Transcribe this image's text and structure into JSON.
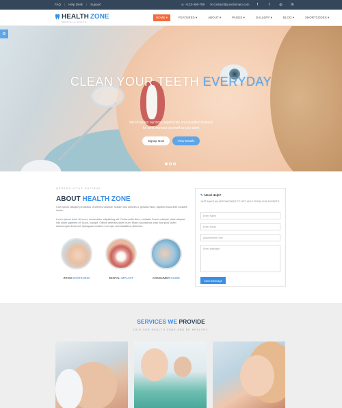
{
  "topbar": {
    "links": [
      "FAQ",
      "Help Desk",
      "Support"
    ],
    "phone": "+123-456-789",
    "email": "contact@yourdomain.com"
  },
  "header": {
    "logo_main": "HEALTH",
    "logo_accent": "ZONE",
    "logo_tagline": "MEDICAL & HEALTH",
    "nav": [
      "HOME",
      "FEATURES",
      "ABOUT",
      "PAGES",
      "GALLERY",
      "BLOG",
      "SHORTCODES"
    ]
  },
  "hero": {
    "title_main": "CLEAN YOUR TEETH",
    "title_accent": "EVERYDAY",
    "subtitle_line1": "We Provides our best opportunity and qualified trainers",
    "subtitle_line2": "for best workout yourself as you want",
    "signup_label": "Signup Now",
    "details_label": "View Details"
  },
  "about": {
    "eyebrow": "QPRADA VITAE DAPIBUS",
    "title_main": "ABOUT",
    "title_accent": "HEALTH ZONE",
    "p1": "Cum sociis natoque penatibus et ultrices volutpat. Nullam wisi ultricies a, gravida vitae, dapibus risus ante sodales lectus.",
    "p2_lead": "Lorem ipsum dolor sit amet",
    "p2": ", consectetur adipisicing elit. Perferendis illum, veritatis! Fusce volutpat, vitae aliquam iste ullam sapiente id! Quos, suscipit. Officiis delectus opimi eum! Etiam accusamus cras tica quos totam doloremque deserunt. Quisquam incidunt eum quo necessitatibus delectus.",
    "features": [
      {
        "name": "ZOOM",
        "accent": "WHITENING"
      },
      {
        "name": "DENTAL",
        "accent": "IMPLANT"
      },
      {
        "name": "CONSUMER",
        "accent": "GUIDE"
      }
    ]
  },
  "appointment": {
    "title": "Need Help?",
    "description": "JUST MAKE AN APPOINTMENT TO GET HELP FROM OUR EXPERTS.",
    "name_placeholder": "Enter Name",
    "email_placeholder": "Enter Email",
    "date_placeholder": "Appointment Date",
    "message_placeholder": "Enter Message",
    "submit_label": "Send Message"
  },
  "services": {
    "title_accent": "SERVICES WE",
    "title_main": "PROVIDE",
    "subtitle": "JOIN OUR HEALTH ZONE AND BE HEALTHY."
  }
}
